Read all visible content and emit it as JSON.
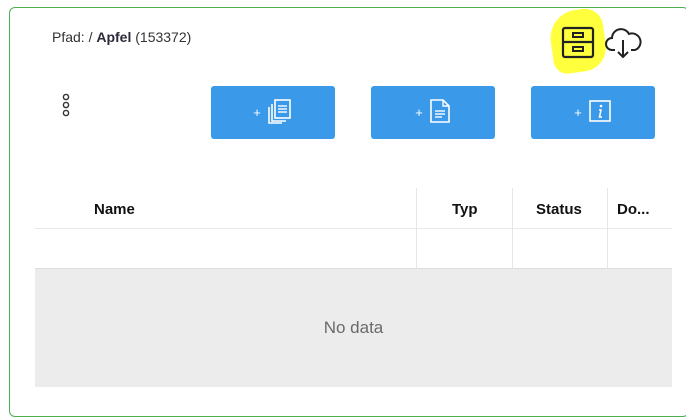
{
  "breadcrumb": {
    "prefix": "Pfad: / ",
    "name": "Apfel",
    "id": "(153372)"
  },
  "icons": {
    "archive": "archive-drawer-icon",
    "download": "cloud-download-icon",
    "menu": "more-vertical-icon"
  },
  "toolbar": {
    "buttons": [
      {
        "plus": "+",
        "icon": "documents-stack-icon"
      },
      {
        "plus": "+",
        "icon": "document-icon"
      },
      {
        "plus": "+",
        "icon": "info-icon"
      }
    ]
  },
  "table": {
    "columns": [
      "Name",
      "Typ",
      "Status",
      "Do..."
    ],
    "empty_text": "No data"
  },
  "colors": {
    "accent": "#3b99e9",
    "frame": "#4caf50",
    "highlight": "#ffff33"
  }
}
